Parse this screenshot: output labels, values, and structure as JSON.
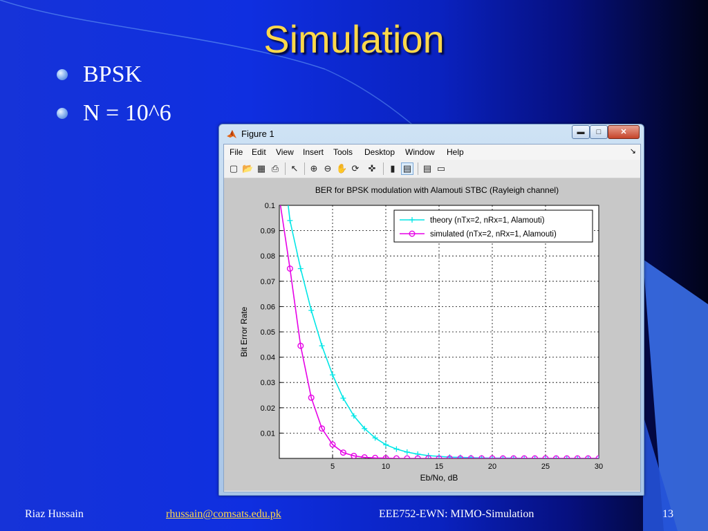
{
  "slide": {
    "title": "Simulation",
    "bullets": [
      "BPSK",
      "N = 10^6"
    ],
    "footer": {
      "author": "Riaz Hussain",
      "email": "rhussain@comsats.edu.pk",
      "course": "EEE752-EWN: MIMO-Simulation",
      "page": "13"
    },
    "colors": {
      "title": "#ffd84a",
      "background": "#0f2fe0"
    }
  },
  "window": {
    "title": "Figure 1",
    "controls": [
      "minimize-icon",
      "maximize-icon",
      "close-icon"
    ],
    "menu": [
      "File",
      "Edit",
      "View",
      "Insert",
      "Tools",
      "Desktop",
      "Window",
      "Help"
    ],
    "toolbar_icons": [
      "new-figure-icon",
      "open-file-icon",
      "save-icon",
      "print-icon",
      "edit-plot-icon",
      "zoom-in-icon",
      "zoom-out-icon",
      "pan-icon",
      "rotate-3d-icon",
      "data-cursor-icon",
      "colorbar-icon",
      "legend-icon",
      "hide-plot-tools-icon",
      "show-plot-tools-icon"
    ]
  },
  "chart_data": {
    "type": "line",
    "title": "BER for BPSK modulation with Alamouti STBC (Rayleigh channel)",
    "xlabel": "Eb/No, dB",
    "ylabel": "Bit Error Rate",
    "xlim": [
      0,
      30
    ],
    "ylim": [
      0,
      0.1
    ],
    "xticks": [
      "5",
      "10",
      "15",
      "20",
      "25",
      "30"
    ],
    "yticks": [
      "0.01",
      "0.02",
      "0.03",
      "0.04",
      "0.05",
      "0.06",
      "0.07",
      "0.08",
      "0.09",
      "0.1"
    ],
    "grid": true,
    "legend_position": "top-right",
    "x": [
      0,
      1,
      2,
      3,
      4,
      5,
      6,
      7,
      8,
      9,
      10,
      11,
      12,
      13,
      14,
      15,
      16,
      17,
      18,
      19,
      20,
      21,
      22,
      23,
      24,
      25,
      26,
      27,
      28,
      29,
      30
    ],
    "series": [
      {
        "name": "theory (nTx=2, nRx=1, Alamouti)",
        "color": "#00e6e6",
        "marker": "plus",
        "values": [
          0.13,
          0.094,
          0.075,
          0.0585,
          0.0445,
          0.033,
          0.0238,
          0.0168,
          0.0118,
          0.0081,
          0.0054,
          0.0037,
          0.0025,
          0.0017,
          0.0011,
          0.0008,
          0.0005,
          0.0004,
          0.0003,
          0.0002,
          0.0001,
          0.0001,
          0.0001,
          0,
          0,
          0,
          0,
          0,
          0,
          0,
          0
        ]
      },
      {
        "name": "simulated (nTx=2, nRx=1, Alamouti)",
        "color": "#e600e6",
        "marker": "circle",
        "values": [
          0.103,
          0.075,
          0.0445,
          0.024,
          0.0118,
          0.0055,
          0.0023,
          0.001,
          0.0004,
          0.0002,
          0.0001,
          0,
          0,
          0,
          0,
          0,
          0,
          0,
          0,
          0,
          0,
          0,
          0,
          0,
          0,
          0,
          0,
          0,
          0,
          0,
          0
        ]
      }
    ]
  }
}
